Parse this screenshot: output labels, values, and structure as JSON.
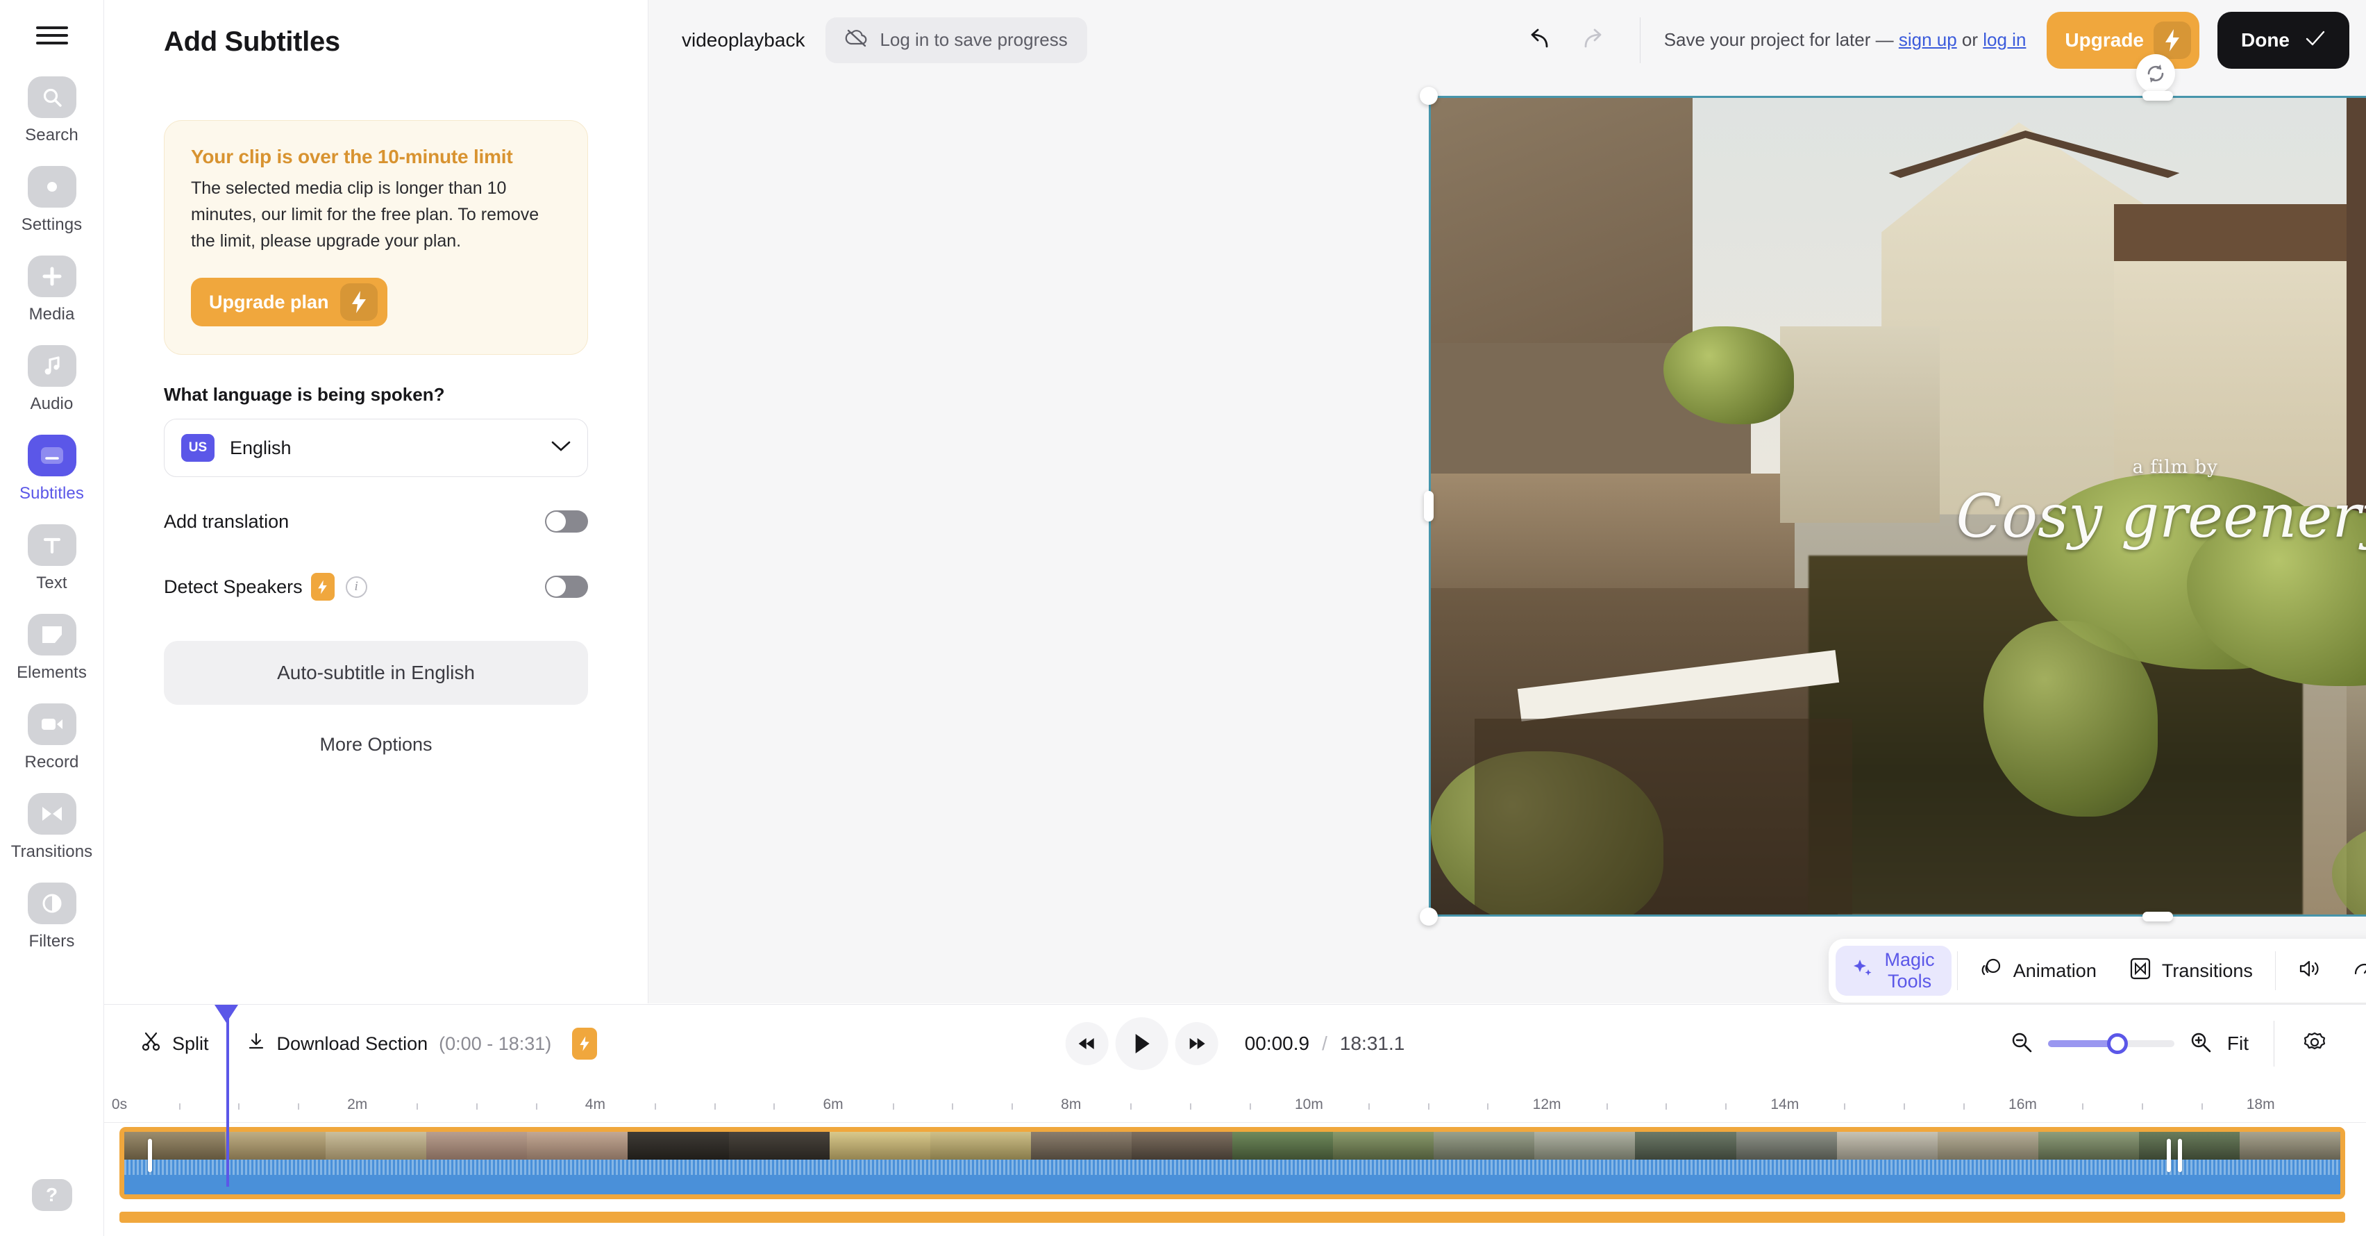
{
  "sidebar": {
    "menu_icon": "hamburger-icon",
    "items": [
      {
        "label": "Search",
        "icon": "search-icon",
        "active": false
      },
      {
        "label": "Settings",
        "icon": "gear-icon",
        "active": false
      },
      {
        "label": "Media",
        "icon": "plus-icon",
        "active": false
      },
      {
        "label": "Audio",
        "icon": "music-note-icon",
        "active": false
      },
      {
        "label": "Subtitles",
        "icon": "subtitles-icon",
        "active": true
      },
      {
        "label": "Text",
        "icon": "text-t-icon",
        "active": false
      },
      {
        "label": "Elements",
        "icon": "elements-icon",
        "active": false
      },
      {
        "label": "Record",
        "icon": "video-camera-icon",
        "active": false
      },
      {
        "label": "Transitions",
        "icon": "transitions-icon",
        "active": false
      },
      {
        "label": "Filters",
        "icon": "contrast-icon",
        "active": false
      }
    ],
    "help_label": "?"
  },
  "panel": {
    "title": "Add Subtitles",
    "alert": {
      "title": "Your clip is over the 10-minute limit",
      "body": "The selected media clip is longer than 10 minutes, our limit for the free plan. To remove the limit, please upgrade your plan.",
      "button_label": "Upgrade plan"
    },
    "language_question": "What language is being spoken?",
    "language": {
      "flag": "US",
      "name": "English"
    },
    "add_translation_label": "Add translation",
    "add_translation_on": false,
    "detect_speakers_label": "Detect Speakers",
    "detect_speakers_on": false,
    "auto_subtitle_label": "Auto-subtitle in English",
    "more_options_label": "More Options"
  },
  "topbar": {
    "project_name": "videoplayback",
    "login_save_label": "Log in to save progress",
    "undo_icon": "undo-arrow-icon",
    "redo_icon": "redo-arrow-icon",
    "refresh_icon": "refresh-icon",
    "save_hint_prefix": "Save your project for later — ",
    "sign_up_label": "sign up",
    "save_hint_joiner": " or ",
    "log_in_label": "log in",
    "upgrade_label": "Upgrade",
    "done_label": "Done"
  },
  "preview": {
    "overlay_small": "a film by",
    "overlay_large": "Cosy greenery"
  },
  "floating_toolbar": {
    "items": [
      {
        "label": "Magic Tools",
        "icon": "sparkles-icon",
        "selected": true
      },
      {
        "label": "Animation",
        "icon": "animation-icon",
        "selected": false
      },
      {
        "label": "Transitions",
        "icon": "transitions-icon",
        "selected": false
      }
    ],
    "volume_icon": "speaker-icon",
    "speed_icon": "speedometer-icon",
    "more_icon": "ellipsis-icon"
  },
  "timeline": {
    "split_label": "Split",
    "download_label": "Download Section",
    "download_range": "(0:00 - 18:31)",
    "skip_back_icon": "rewind-icon",
    "play_icon": "play-icon",
    "skip_forward_icon": "fast-forward-icon",
    "current_time": "00:00.9",
    "time_separator": "/",
    "total_time": "18:31.1",
    "zoom_out_icon": "zoom-out-icon",
    "zoom_in_icon": "zoom-in-icon",
    "zoom_value": 55,
    "fit_label": "Fit",
    "settings_icon": "gear-icon",
    "ruler_labels": [
      "0s",
      "2m",
      "4m",
      "6m",
      "8m",
      "10m",
      "12m",
      "14m",
      "16m",
      "18m"
    ]
  },
  "colors": {
    "accent": "#5b57e8",
    "warning": "#f0a73d",
    "clip_border": "#f0a73d",
    "audio_wave": "#4a90d9",
    "selection": "#4795ab",
    "done_bg": "#141417"
  }
}
